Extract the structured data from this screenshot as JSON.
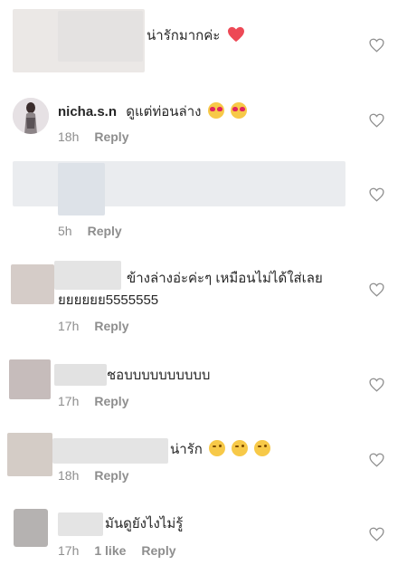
{
  "comments": [
    {
      "text": "น่ารักมากค่ะ",
      "emoji": "red-heart",
      "time": "",
      "reply": "",
      "likes": ""
    },
    {
      "username": "nicha.s.n",
      "text": "ดูแต่ท่อนล่าง",
      "emoji": "heart-eyes",
      "time": "18h",
      "reply": "Reply"
    },
    {
      "text": "",
      "time": "5h",
      "reply": "Reply"
    },
    {
      "text_line1": "ข้างล่างอ่ะค่ะๆ เหมือนไม่ได้ใส่เลย",
      "text_line2": "ยยยยยย5555555",
      "time": "17h",
      "reply": "Reply"
    },
    {
      "text": "ชอบบบบบบบบบบ",
      "time": "17h",
      "reply": "Reply"
    },
    {
      "text": "น่ารัก",
      "emoji": "winking-face",
      "time": "18h",
      "reply": "Reply"
    },
    {
      "text": "มันดูยังไงไม่รู้",
      "time": "17h",
      "likes": "1 like",
      "reply": "Reply"
    }
  ],
  "icons": {
    "like": "heart-outline-icon"
  },
  "colors": {
    "text": "#262626",
    "meta": "#8e8e8e",
    "heart_red": "#ed4956"
  }
}
